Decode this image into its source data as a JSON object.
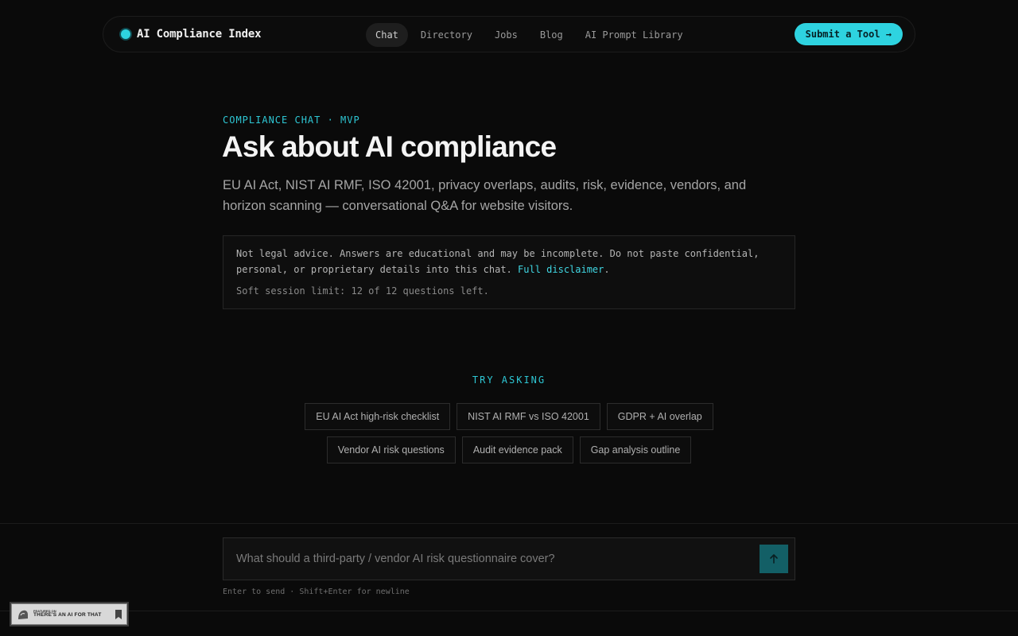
{
  "nav": {
    "brand": "AI Compliance Index",
    "links": [
      "Chat",
      "Directory",
      "Jobs",
      "Blog",
      "AI Prompt Library"
    ],
    "active_index": 0,
    "submit_label": "Submit a Tool →"
  },
  "hero": {
    "eyebrow": "COMPLIANCE CHAT · MVP",
    "title": "Ask about AI compliance",
    "subtitle": "EU AI Act, NIST AI RMF, ISO 42001, privacy overlaps, audits, risk, evidence, vendors, and horizon scanning — conversational Q&A for website visitors."
  },
  "notice": {
    "text": "Not legal advice. Answers are educational and may be incomplete. Do not paste confidential, personal, or proprietary details into this chat. ",
    "link_label": "Full disclaimer",
    "link_suffix": ".",
    "limit": "Soft session limit: 12 of 12 questions left."
  },
  "suggestions": {
    "label": "TRY ASKING",
    "row1": [
      "EU AI Act high-risk checklist",
      "NIST AI RMF vs ISO 42001",
      "GDPR + AI overlap"
    ],
    "row2": [
      "Vendor AI risk questions",
      "Audit evidence pack",
      "Gap analysis outline"
    ]
  },
  "composer": {
    "placeholder": "What should a third-party / vendor AI risk questionnaire cover?",
    "hint": "Enter to send · Shift+Enter for newline",
    "send_icon": "arrow-up-icon"
  },
  "badge": {
    "small": "FEATURED ON",
    "main": "THERE'S AN AI FOR THAT"
  },
  "colors": {
    "accent": "#2ed3e0",
    "background": "#0a0a0a"
  }
}
